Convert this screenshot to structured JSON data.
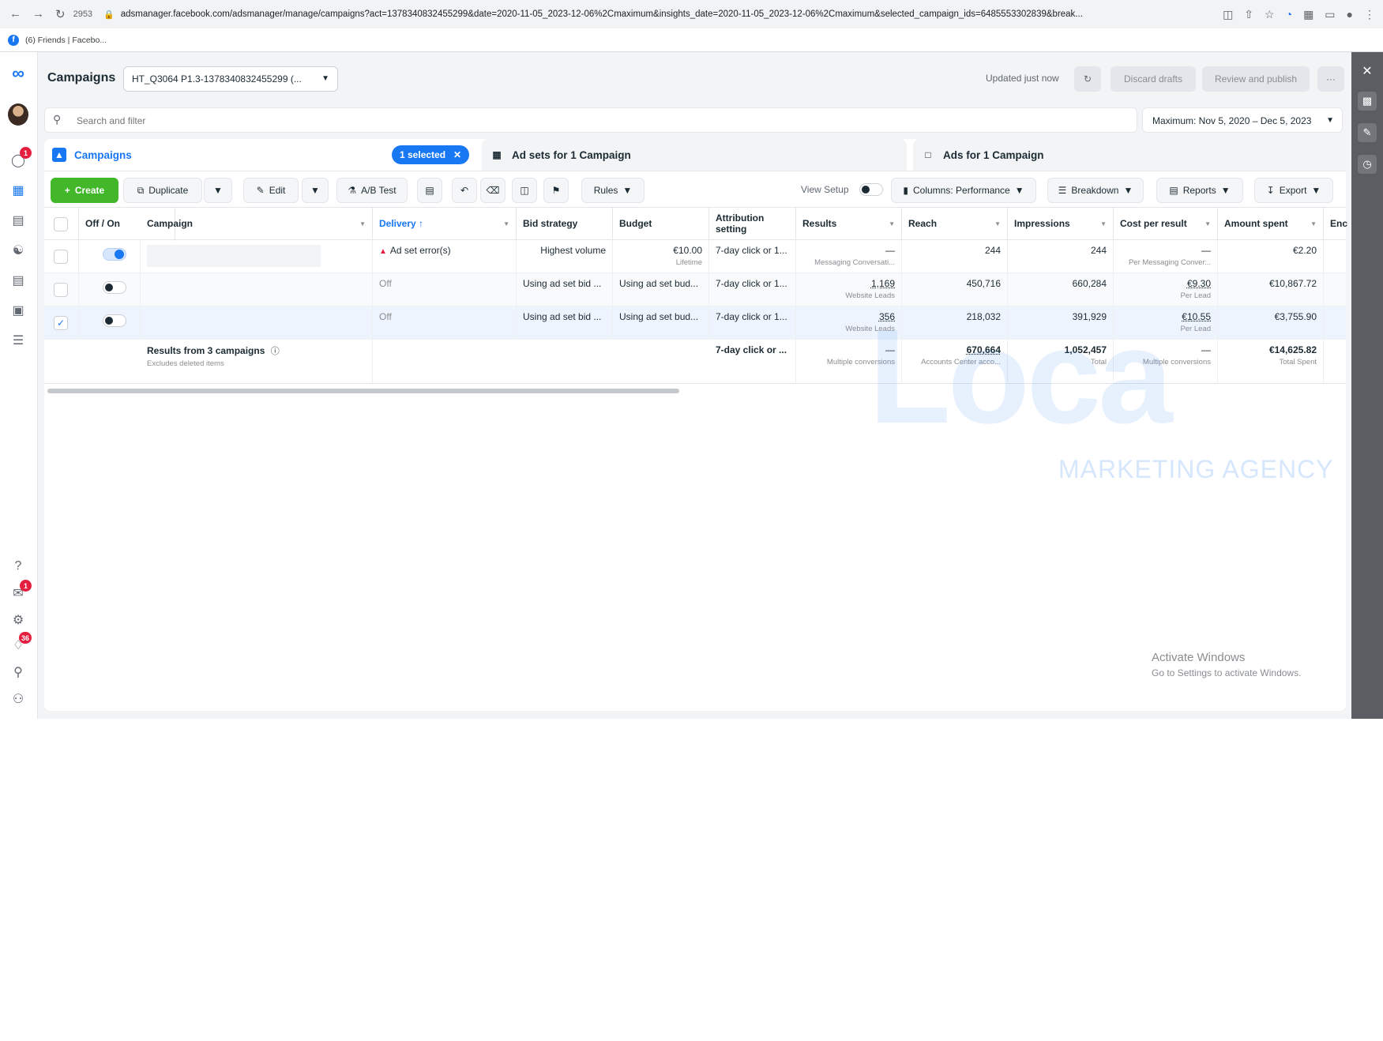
{
  "browser": {
    "tab_count": "2953",
    "url": "adsmanager.facebook.com/adsmanager/manage/campaigns?act=1378340832455299&date=2020-11-05_2023-12-06%2Cmaximum&insights_date=2020-11-05_2023-12-06%2Cmaximum&selected_campaign_ids=6485553302839&break...",
    "bookmark": "(6) Friends | Facebo..."
  },
  "header": {
    "title": "Campaigns",
    "account": "HT_Q3064 P1.3-1378340832455299 (...",
    "updated": "Updated just now",
    "discard": "Discard drafts",
    "review": "Review and publish",
    "more": "···"
  },
  "search": {
    "placeholder": "Search and filter",
    "date_range": "Maximum: Nov 5, 2020 – Dec 5, 2023"
  },
  "tabs": {
    "campaigns": "Campaigns",
    "selected": "1 selected",
    "adsets": "Ad sets for 1 Campaign",
    "ads": "Ads for 1 Campaign"
  },
  "toolbar": {
    "create": "Create",
    "duplicate": "Duplicate",
    "edit": "Edit",
    "ab_test": "A/B Test",
    "rules": "Rules",
    "view_setup": "View Setup",
    "columns": "Columns: Performance",
    "breakdown": "Breakdown",
    "reports": "Reports",
    "export": "Export"
  },
  "columns": {
    "offon": "Off / On",
    "campaign": "Campaign",
    "delivery": "Delivery ↑",
    "bid": "Bid strategy",
    "budget": "Budget",
    "attribution": "Attribution setting",
    "results": "Results",
    "reach": "Reach",
    "impressions": "Impressions",
    "cpr": "Cost per result",
    "spent": "Amount spent",
    "ends": "Enc"
  },
  "rows": [
    {
      "delivery": "Ad set error(s)",
      "bid": "Highest volume",
      "budget": "€10.00",
      "budget_sub": "Lifetime",
      "attribution": "7-day click or 1...",
      "results": "—",
      "results_sub": "Messaging Conversati...",
      "reach": "244",
      "impressions": "244",
      "cpr": "—",
      "cpr_sub": "Per Messaging Conver...",
      "spent": "€2.20"
    },
    {
      "delivery": "Off",
      "bid": "Using ad set bid ...",
      "budget": "Using ad set bud...",
      "attribution": "7-day click or 1...",
      "results": "1,169",
      "results_sub": "Website Leads",
      "reach": "450,716",
      "impressions": "660,284",
      "cpr": "€9.30",
      "cpr_sub": "Per Lead",
      "spent": "€10,867.72"
    },
    {
      "delivery": "Off",
      "bid": "Using ad set bid ...",
      "budget": "Using ad set bud...",
      "attribution": "7-day click or 1...",
      "results": "356",
      "results_sub": "Website Leads",
      "reach": "218,032",
      "impressions": "391,929",
      "cpr": "€10.55",
      "cpr_sub": "Per Lead",
      "spent": "€3,755.90"
    }
  ],
  "summary": {
    "label": "Results from 3 campaigns",
    "sub": "Excludes deleted items",
    "attribution": "7-day click or ...",
    "results": "—",
    "results_sub": "Multiple conversions",
    "reach": "670,664",
    "reach_sub": "Accounts Center acco...",
    "impressions": "1,052,457",
    "impressions_sub": "Total",
    "cpr": "—",
    "cpr_sub": "Multiple conversions",
    "spent": "€14,625.82",
    "spent_sub": "Total Spent"
  },
  "watermark": {
    "brand": "Loca",
    "tagline": "MARKETING AGENCY"
  },
  "os": {
    "activate_title": "Activate Windows",
    "activate_sub": "Go to Settings to activate Windows."
  },
  "badges": {
    "notifications": "1",
    "inbox": "1",
    "alerts": "36"
  },
  "colors": {
    "accent": "#1877f2",
    "create": "#42b72a",
    "error": "#e41e3f"
  }
}
